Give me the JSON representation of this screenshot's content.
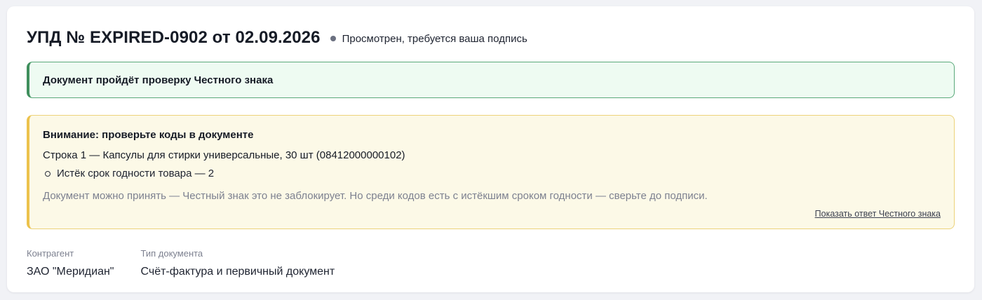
{
  "document": {
    "title": "УПД № EXPIRED-0902 от 02.09.2026",
    "status_text": "Просмотрен, требуется ваша подпись"
  },
  "success_alert": {
    "text": "Документ пройдёт проверку Честного знака"
  },
  "warning_alert": {
    "title": "Внимание: проверьте коды в документе",
    "line_text": "Строка 1 — Капсулы для стирки универсальные, 30 шт (08412000000102)",
    "issues": [
      "Истёк срок годности товара — 2"
    ],
    "note": "Документ можно принять — Честный знак это не заблокирует. Но среди кодов есть с истёкшим сроком годности — сверьте до подписи.",
    "link_label": "Показать ответ Честного знака"
  },
  "meta": {
    "counterparty_label": "Контрагент",
    "counterparty_value": "ЗАО \"Меридиан\"",
    "doctype_label": "Тип документа",
    "doctype_value": "Счёт-фактура и первичный документ"
  },
  "colors": {
    "success_bg": "#eefbf2",
    "success_border": "#3f8f5d",
    "warning_bg": "#fcf9e7",
    "warning_border": "#ecc24c",
    "status_dot": "#6b7080"
  }
}
